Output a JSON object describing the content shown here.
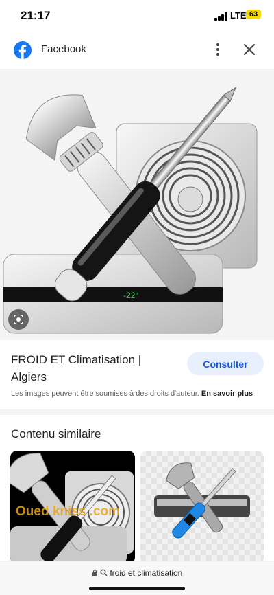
{
  "status": {
    "time": "21:17",
    "network": "LTE",
    "battery": "63"
  },
  "header": {
    "site_name": "Facebook"
  },
  "result": {
    "title": "FROID ET Climatisation | Algiers",
    "visit_label": "Consulter",
    "copyright_notice": "Les images peuvent être soumises à des droits d'auteur.",
    "learn_more_label": "En savoir plus"
  },
  "hero_display_text": "-22°",
  "similar": {
    "heading": "Contenu similaire",
    "watermark": "Oued kniss .com"
  },
  "urlbar": {
    "query": "froid et climatisation"
  },
  "colors": {
    "accent": "#1a57d6",
    "button_bg": "#e8f0fe",
    "facebook": "#1877f2",
    "battery": "#f5d90a"
  }
}
